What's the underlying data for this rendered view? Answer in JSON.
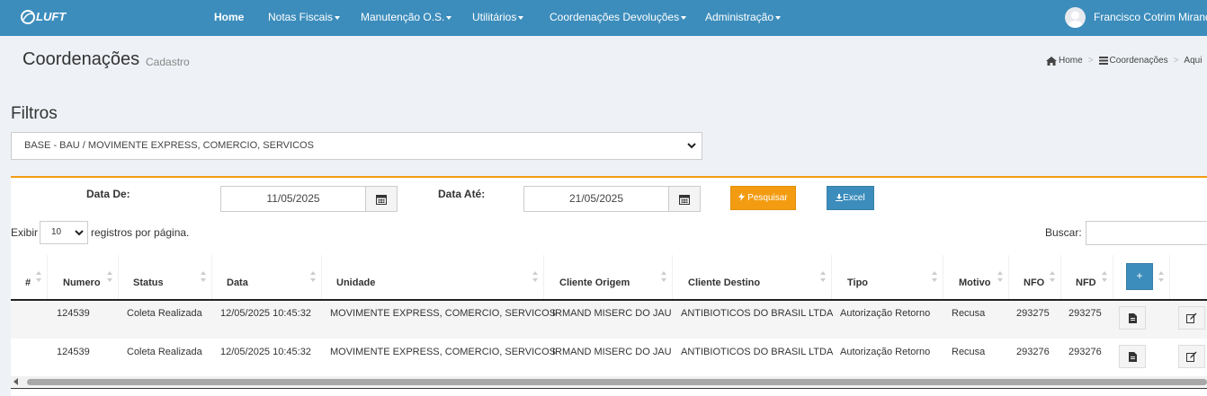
{
  "nav": {
    "logo_text": "LUFT",
    "items": [
      {
        "label": "Home",
        "active": true
      },
      {
        "label": "Notas Fiscais",
        "dropdown": true
      },
      {
        "label": "Manutenção O.S.",
        "dropdown": true
      },
      {
        "label": "Utilitários",
        "dropdown": true
      },
      {
        "label": "Coordenações Devoluções",
        "dropdown": true
      },
      {
        "label": "Administração",
        "dropdown": true
      }
    ],
    "user_name": "Francisco Cotrim Mirand"
  },
  "header": {
    "title": "Coordenações",
    "subtitle": "Cadastro",
    "breadcrumb": [
      "Home",
      "Coordenações",
      "Aqui"
    ]
  },
  "filters": {
    "title": "Filtros",
    "base_selected": "BASE - BAU / MOVIMENTE EXPRESS, COMERCIO, SERVICOS",
    "date_from_label": "Data De:",
    "date_from_value": "11/05/2025",
    "date_to_label": "Data Até:",
    "date_to_value": "21/05/2025",
    "search_button": "Pesquisar",
    "excel_button": "Excel"
  },
  "table_controls": {
    "show_label": "Exibir",
    "page_length": "10",
    "per_page_label": "registros por página.",
    "search_label": "Buscar:",
    "search_value": "",
    "add_label": "+"
  },
  "table": {
    "columns": [
      "#",
      "Numero",
      "Status",
      "Data",
      "Unidade",
      "Cliente Origem",
      "Cliente Destino",
      "Tipo",
      "Motivo",
      "NFO",
      "NFD"
    ],
    "rows": [
      {
        "num": "",
        "numero": "124539",
        "status": "Coleta Realizada",
        "data": "12/05/2025 10:45:32",
        "unidade": "MOVIMENTE EXPRESS, COMERCIO, SERVICOS",
        "origem": "IRMAND MISERC DO JAU",
        "destino": "ANTIBIOTICOS DO BRASIL LTDA",
        "tipo": "Autorização Retorno",
        "motivo": "Recusa",
        "nfo": "293275",
        "nfd": "293275"
      },
      {
        "num": "",
        "numero": "124539",
        "status": "Coleta Realizada",
        "data": "12/05/2025 10:45:32",
        "unidade": "MOVIMENTE EXPRESS, COMERCIO, SERVICOS",
        "origem": "IRMAND MISERC DO JAU",
        "destino": "ANTIBIOTICOS DO BRASIL LTDA",
        "tipo": "Autorização Retorno",
        "motivo": "Recusa",
        "nfo": "293276",
        "nfd": "293276"
      }
    ]
  },
  "colors": {
    "navbar": "#3c8dbc",
    "accent_orange": "#f39c12",
    "primary_button": "#3c8dbc"
  }
}
